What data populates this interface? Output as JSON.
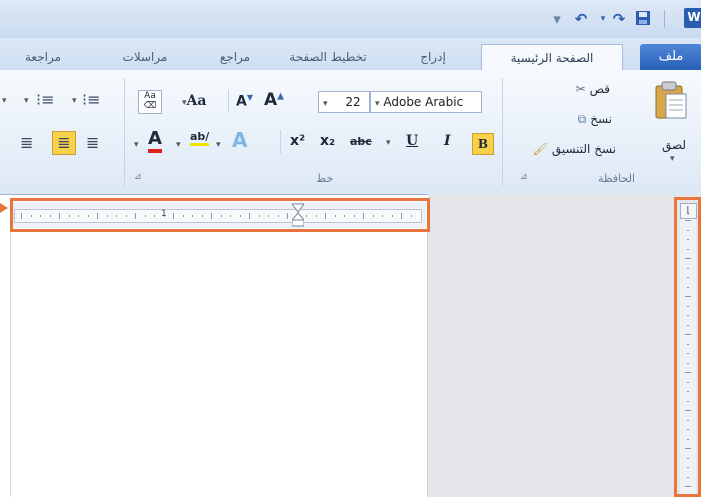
{
  "quick_access": {
    "qa_icons": [
      "save-icon",
      "redo-icon",
      "undo-icon",
      "customize-icon",
      "word-icon"
    ]
  },
  "tabs": [
    {
      "label": "ملف"
    },
    {
      "label": "الصفحة الرئيسية"
    },
    {
      "label": "إدراج"
    },
    {
      "label": "تخطيط الصفحة"
    },
    {
      "label": "مراجع"
    },
    {
      "label": "مراسلات"
    },
    {
      "label": "مراجعة"
    }
  ],
  "clipboard": {
    "paste_label": "لصق",
    "cut_label": "قص",
    "copy_label": "نسخ",
    "format_painter_label": "نسخ التنسيق",
    "group_label": "الحافظة"
  },
  "font": {
    "font_name": "Adobe Arabic",
    "font_size": "22",
    "group_label": "خط",
    "bold": "B",
    "italic": "I",
    "underline": "U",
    "strike": "abc",
    "subscript": "x₂",
    "superscript": "x²",
    "grow": "A",
    "shrink": "A",
    "change_case": "Aa"
  },
  "colors": {
    "accent": "#e9743d",
    "file_tab": "#2f6bc4",
    "highlight": "#f7d14a"
  }
}
